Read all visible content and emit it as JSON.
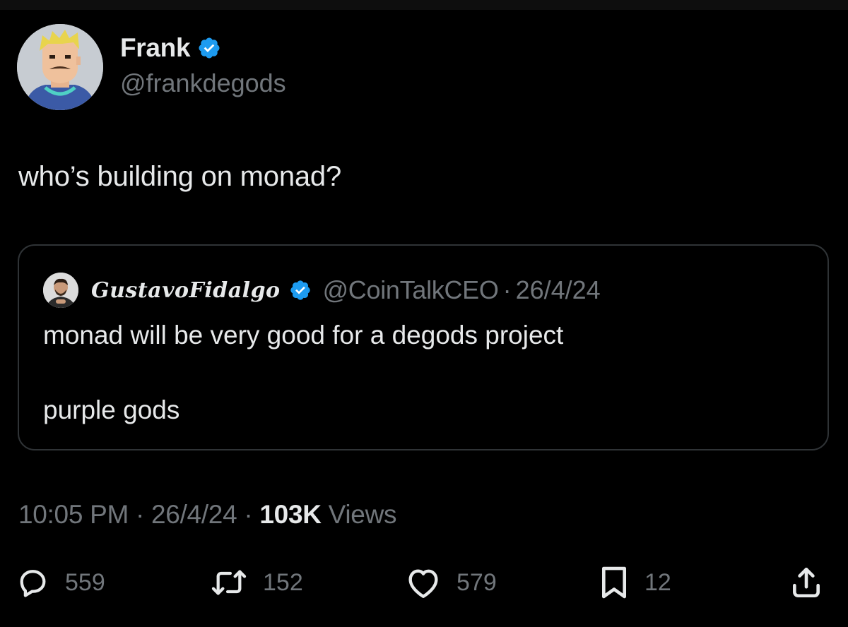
{
  "author": {
    "name": "Frank",
    "handle": "@frankdegods",
    "verified": true
  },
  "tweet": {
    "text": "who’s building on monad?"
  },
  "quote": {
    "author_name": "GustavoFidalgo",
    "handle": "@CoinTalkCEO",
    "separator": "·",
    "date": "26/4/24",
    "line1": "monad will be very good for a degods project",
    "line2": "purple gods"
  },
  "meta": {
    "time": "10:05 PM",
    "separator": "·",
    "date": "26/4/24",
    "views_count": "103K",
    "views_label": "Views"
  },
  "actions": {
    "replies": "559",
    "reposts": "152",
    "likes": "579",
    "bookmarks": "12"
  },
  "colors": {
    "background": "#000000",
    "text": "#e7e9ea",
    "secondary": "#71767b",
    "verified": "#1d9bf0",
    "border": "#2f3336"
  },
  "icons": {
    "verified": "verified-badge-icon",
    "reply": "reply-icon",
    "repost": "repost-icon",
    "like": "heart-icon",
    "bookmark": "bookmark-icon",
    "share": "share-icon"
  }
}
